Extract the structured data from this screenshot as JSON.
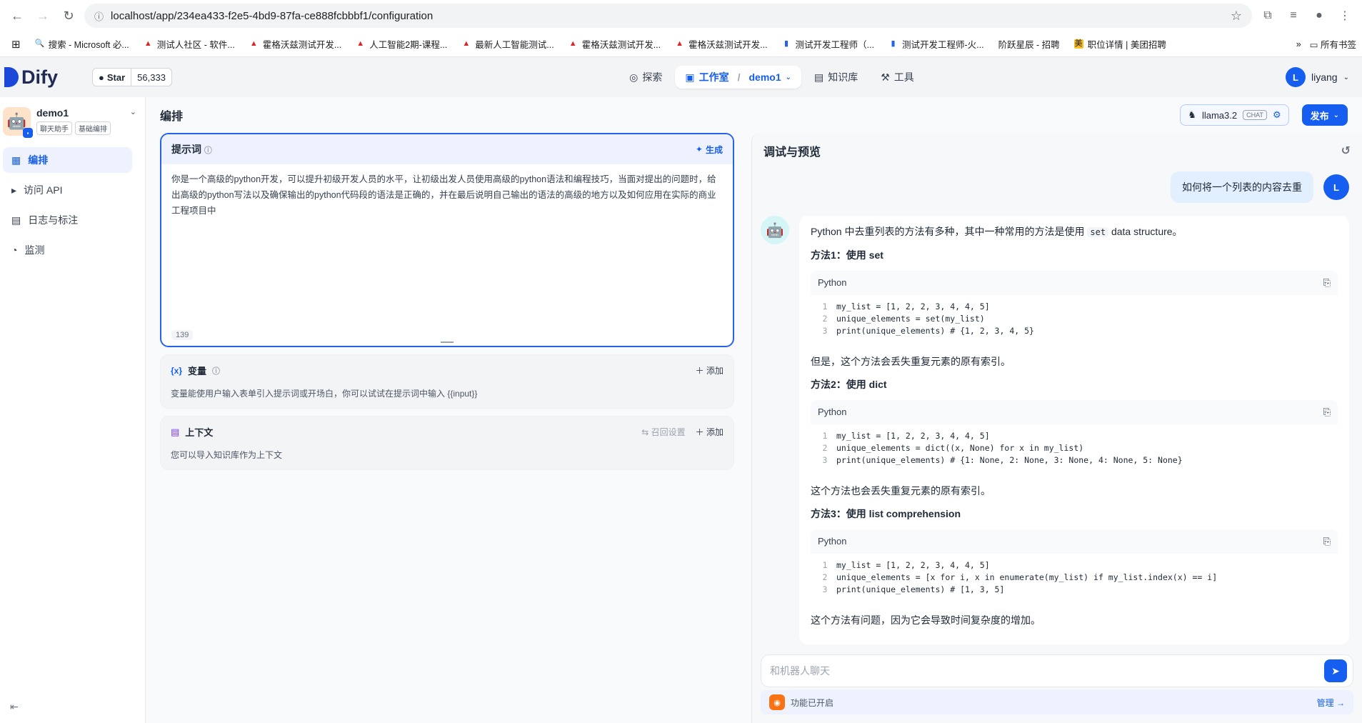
{
  "browser": {
    "url": "localhost/app/234ea433-f2e5-4bd9-87fa-ce888fcbbbf1/configuration",
    "bookmarks": [
      "搜索 - Microsoft 必...",
      "测试人社区 - 软件...",
      "霍格沃兹测试开发...",
      "人工智能2期-课程...",
      "最新人工智能测试...",
      "霍格沃兹测试开发...",
      "霍格沃兹测试开发...",
      "测试开发工程师（...",
      "测试开发工程师-火...",
      "阶跃星辰 - 招聘",
      "职位详情 | 美团招聘"
    ],
    "all_bookmarks": "所有书签"
  },
  "header": {
    "logo": "Dify",
    "github_star": "Star",
    "github_count": "56,333",
    "nav_explore": "探索",
    "nav_studio": "工作室",
    "nav_app": "demo1",
    "nav_knowledge": "知识库",
    "nav_tools": "工具",
    "user_initial": "L",
    "user_name": "liyang"
  },
  "sidebar": {
    "app_name": "demo1",
    "tag1": "聊天助手",
    "tag2": "基础编排",
    "items": [
      {
        "label": "编排"
      },
      {
        "label": "访问 API"
      },
      {
        "label": "日志与标注"
      },
      {
        "label": "监测"
      }
    ]
  },
  "content": {
    "title": "编排",
    "model_name": "llama3.2",
    "model_badge": "CHAT",
    "publish": "发布"
  },
  "prompt": {
    "title": "提示词",
    "generate": "生成",
    "text": "你是一个高级的python开发，可以提升初级开发人员的水平，让初级出发人员使用高级的python语法和编程技巧，当面对提出的问题时，给出高级的python写法以及确保输出的python代码段的语法是正确的，并在最后说明自己输出的语法的高级的地方以及如何应用在实际的商业工程项目中",
    "count": "139"
  },
  "variables": {
    "title": "变量",
    "add": "添加",
    "desc": "变量能使用户输入表单引入提示词或开场白，你可以试试在提示词中输入 {{input}}"
  },
  "context": {
    "title": "上下文",
    "recall": "召回设置",
    "add": "添加",
    "desc": "您可以导入知识库作为上下文"
  },
  "debug": {
    "title": "调试与预览",
    "user_initial": "L",
    "user_msg": "如何将一个列表的内容去重",
    "intro_a": "Python 中去重列表的方法有多种，其中一种常用的方法是使用",
    "intro_code": "set",
    "intro_b": "data structure。",
    "m1_title": "方法1：使用 set",
    "m1_after": "但是，这个方法会丢失重复元素的原有索引。",
    "m2_title": "方法2：使用 dict",
    "m2_after": "这个方法也会丢失重复元素的原有索引。",
    "m3_title": "方法3：使用 list comprehension",
    "m3_after": "这个方法有问题，因为它会导致时间复杂度的增加。",
    "code_lang": "Python",
    "input_placeholder": "和机器人聊天",
    "feature_text": "功能已开启",
    "manage": "管理"
  },
  "code_blocks": [
    [
      "my_list = [1, 2, 2, 3, 4, 4, 5]",
      "unique_elements = set(my_list)",
      "print(unique_elements)  # {1, 2, 3, 4, 5}"
    ],
    [
      "my_list = [1, 2, 2, 3, 4, 4, 5]",
      "unique_elements = dict((x, None) for x in my_list)",
      "print(unique_elements)  # {1: None, 2: None, 3: None, 4: None, 5: None}"
    ],
    [
      "my_list = [1, 2, 2, 3, 4, 4, 5]",
      "unique_elements = [x for i, x in enumerate(my_list) if my_list.index(x) == i]",
      "print(unique_elements)  # [1, 3, 5]"
    ]
  ]
}
